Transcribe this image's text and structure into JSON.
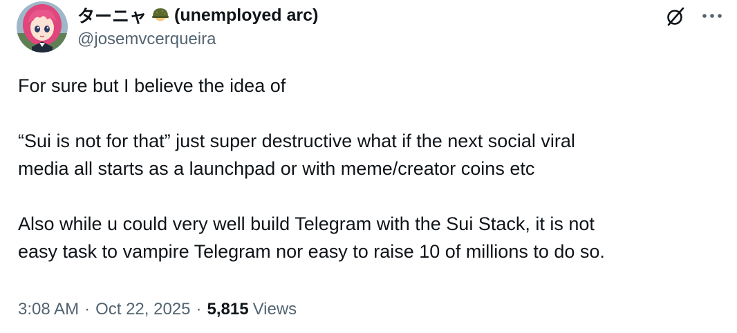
{
  "author": {
    "display_name_prefix": "ターニャ",
    "display_name_emoji": "military-helmet-icon",
    "display_name_suffix": "(unemployed arc)",
    "handle": "@josemvcerqueira",
    "avatar": "anime-avatar-pink-hair"
  },
  "header_actions": {
    "grok_icon": "grok-slash-circle-icon",
    "more_icon": "more-dots-icon"
  },
  "tweet": {
    "paragraphs": [
      [
        "For sure but I believe the idea of"
      ],
      [
        "“Sui is not for that” just super destructive what if the next social viral",
        "media all starts as a launchpad or with meme/creator coins etc"
      ],
      [
        "Also while u could very well build Telegram with the Sui Stack, it is not",
        "easy task to vampire Telegram nor easy to raise 10 of millions to do so."
      ]
    ]
  },
  "meta": {
    "time": "3:08 AM",
    "separator": "·",
    "date": "Oct 22, 2025",
    "views_count": "5,815",
    "views_label": "Views"
  },
  "colors": {
    "text_primary": "#0f1419",
    "text_secondary": "#536471"
  }
}
